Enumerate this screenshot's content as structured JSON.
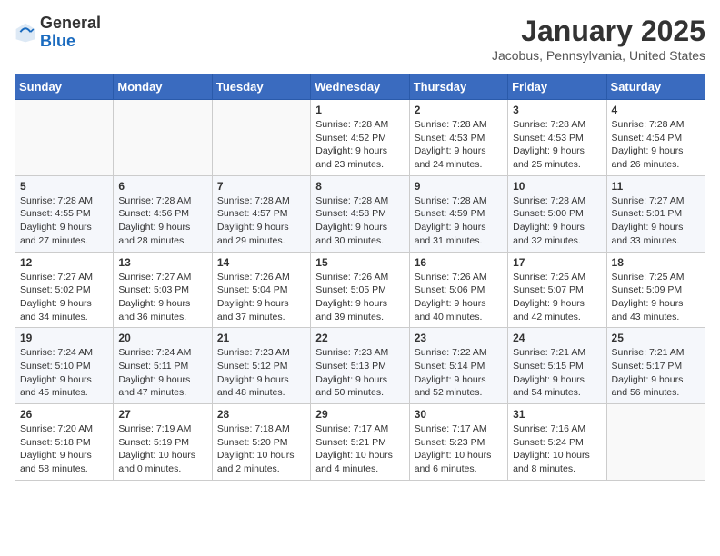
{
  "header": {
    "logo_general": "General",
    "logo_blue": "Blue",
    "month_title": "January 2025",
    "location": "Jacobus, Pennsylvania, United States"
  },
  "days_of_week": [
    "Sunday",
    "Monday",
    "Tuesday",
    "Wednesday",
    "Thursday",
    "Friday",
    "Saturday"
  ],
  "weeks": [
    [
      {
        "day": "",
        "info": ""
      },
      {
        "day": "",
        "info": ""
      },
      {
        "day": "",
        "info": ""
      },
      {
        "day": "1",
        "info": "Sunrise: 7:28 AM\nSunset: 4:52 PM\nDaylight: 9 hours\nand 23 minutes."
      },
      {
        "day": "2",
        "info": "Sunrise: 7:28 AM\nSunset: 4:53 PM\nDaylight: 9 hours\nand 24 minutes."
      },
      {
        "day": "3",
        "info": "Sunrise: 7:28 AM\nSunset: 4:53 PM\nDaylight: 9 hours\nand 25 minutes."
      },
      {
        "day": "4",
        "info": "Sunrise: 7:28 AM\nSunset: 4:54 PM\nDaylight: 9 hours\nand 26 minutes."
      }
    ],
    [
      {
        "day": "5",
        "info": "Sunrise: 7:28 AM\nSunset: 4:55 PM\nDaylight: 9 hours\nand 27 minutes."
      },
      {
        "day": "6",
        "info": "Sunrise: 7:28 AM\nSunset: 4:56 PM\nDaylight: 9 hours\nand 28 minutes."
      },
      {
        "day": "7",
        "info": "Sunrise: 7:28 AM\nSunset: 4:57 PM\nDaylight: 9 hours\nand 29 minutes."
      },
      {
        "day": "8",
        "info": "Sunrise: 7:28 AM\nSunset: 4:58 PM\nDaylight: 9 hours\nand 30 minutes."
      },
      {
        "day": "9",
        "info": "Sunrise: 7:28 AM\nSunset: 4:59 PM\nDaylight: 9 hours\nand 31 minutes."
      },
      {
        "day": "10",
        "info": "Sunrise: 7:28 AM\nSunset: 5:00 PM\nDaylight: 9 hours\nand 32 minutes."
      },
      {
        "day": "11",
        "info": "Sunrise: 7:27 AM\nSunset: 5:01 PM\nDaylight: 9 hours\nand 33 minutes."
      }
    ],
    [
      {
        "day": "12",
        "info": "Sunrise: 7:27 AM\nSunset: 5:02 PM\nDaylight: 9 hours\nand 34 minutes."
      },
      {
        "day": "13",
        "info": "Sunrise: 7:27 AM\nSunset: 5:03 PM\nDaylight: 9 hours\nand 36 minutes."
      },
      {
        "day": "14",
        "info": "Sunrise: 7:26 AM\nSunset: 5:04 PM\nDaylight: 9 hours\nand 37 minutes."
      },
      {
        "day": "15",
        "info": "Sunrise: 7:26 AM\nSunset: 5:05 PM\nDaylight: 9 hours\nand 39 minutes."
      },
      {
        "day": "16",
        "info": "Sunrise: 7:26 AM\nSunset: 5:06 PM\nDaylight: 9 hours\nand 40 minutes."
      },
      {
        "day": "17",
        "info": "Sunrise: 7:25 AM\nSunset: 5:07 PM\nDaylight: 9 hours\nand 42 minutes."
      },
      {
        "day": "18",
        "info": "Sunrise: 7:25 AM\nSunset: 5:09 PM\nDaylight: 9 hours\nand 43 minutes."
      }
    ],
    [
      {
        "day": "19",
        "info": "Sunrise: 7:24 AM\nSunset: 5:10 PM\nDaylight: 9 hours\nand 45 minutes."
      },
      {
        "day": "20",
        "info": "Sunrise: 7:24 AM\nSunset: 5:11 PM\nDaylight: 9 hours\nand 47 minutes."
      },
      {
        "day": "21",
        "info": "Sunrise: 7:23 AM\nSunset: 5:12 PM\nDaylight: 9 hours\nand 48 minutes."
      },
      {
        "day": "22",
        "info": "Sunrise: 7:23 AM\nSunset: 5:13 PM\nDaylight: 9 hours\nand 50 minutes."
      },
      {
        "day": "23",
        "info": "Sunrise: 7:22 AM\nSunset: 5:14 PM\nDaylight: 9 hours\nand 52 minutes."
      },
      {
        "day": "24",
        "info": "Sunrise: 7:21 AM\nSunset: 5:15 PM\nDaylight: 9 hours\nand 54 minutes."
      },
      {
        "day": "25",
        "info": "Sunrise: 7:21 AM\nSunset: 5:17 PM\nDaylight: 9 hours\nand 56 minutes."
      }
    ],
    [
      {
        "day": "26",
        "info": "Sunrise: 7:20 AM\nSunset: 5:18 PM\nDaylight: 9 hours\nand 58 minutes."
      },
      {
        "day": "27",
        "info": "Sunrise: 7:19 AM\nSunset: 5:19 PM\nDaylight: 10 hours\nand 0 minutes."
      },
      {
        "day": "28",
        "info": "Sunrise: 7:18 AM\nSunset: 5:20 PM\nDaylight: 10 hours\nand 2 minutes."
      },
      {
        "day": "29",
        "info": "Sunrise: 7:17 AM\nSunset: 5:21 PM\nDaylight: 10 hours\nand 4 minutes."
      },
      {
        "day": "30",
        "info": "Sunrise: 7:17 AM\nSunset: 5:23 PM\nDaylight: 10 hours\nand 6 minutes."
      },
      {
        "day": "31",
        "info": "Sunrise: 7:16 AM\nSunset: 5:24 PM\nDaylight: 10 hours\nand 8 minutes."
      },
      {
        "day": "",
        "info": ""
      }
    ]
  ]
}
